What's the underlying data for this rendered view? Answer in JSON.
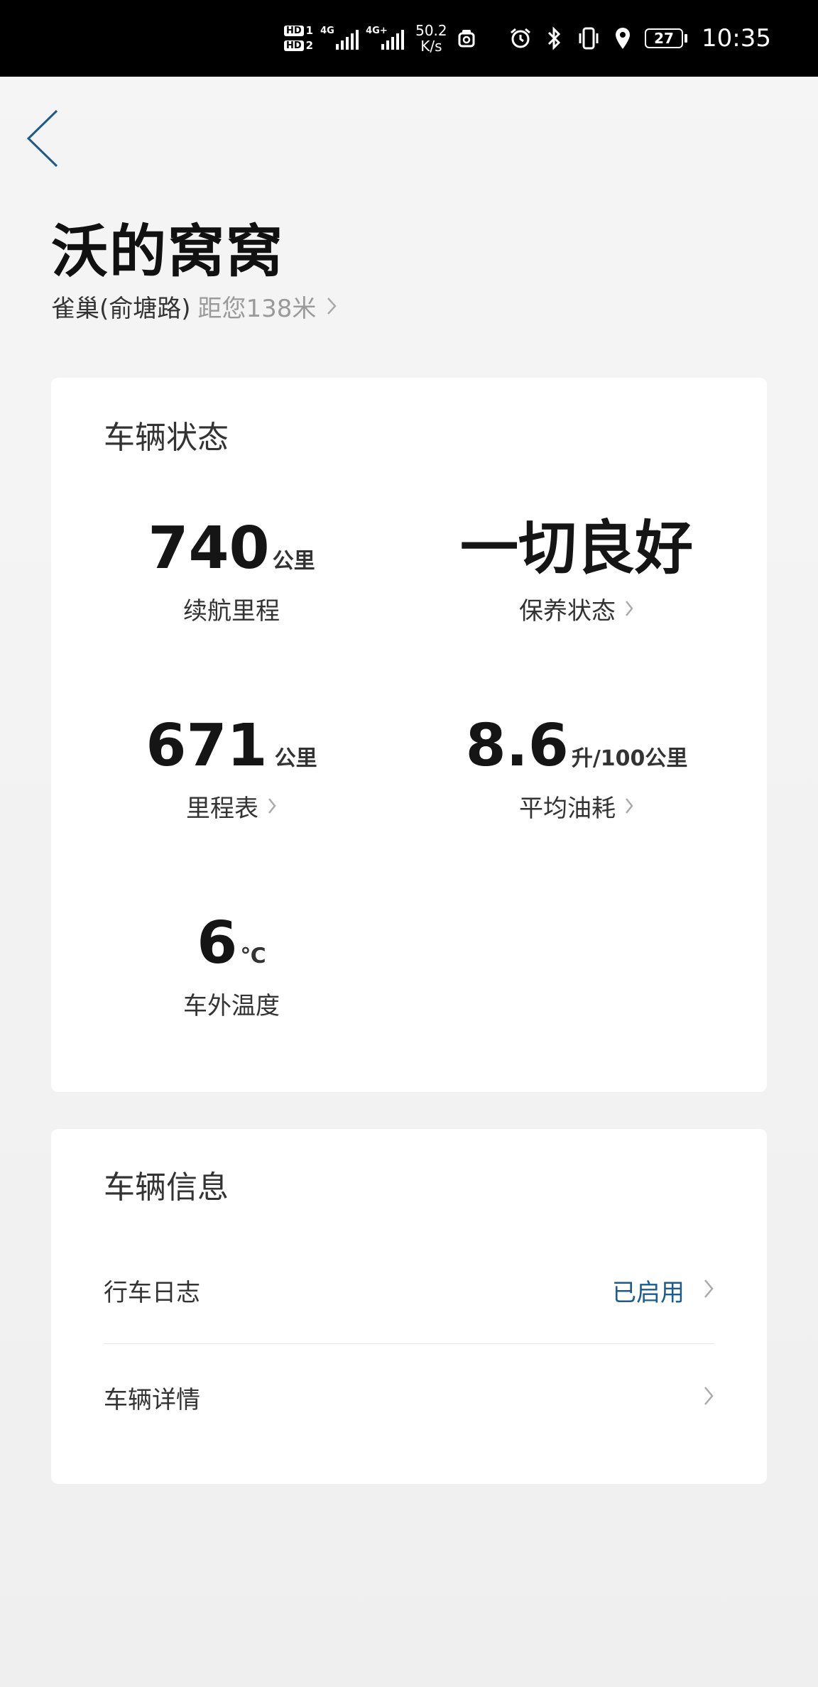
{
  "status_bar": {
    "hd1": "HD",
    "hd1_num": "1",
    "hd2": "HD",
    "hd2_num": "2",
    "sim1_tag": "4G",
    "sim2_tag": "4G+",
    "speed_value": "50.2",
    "speed_unit": "K/s",
    "battery": "27",
    "time": "10:35"
  },
  "header": {
    "title": "沃的窝窝",
    "location_name": "雀巢(俞塘路)",
    "location_distance": "距您138米"
  },
  "vehicle_status": {
    "title": "车辆状态",
    "items": [
      {
        "value": "740",
        "unit": "公里",
        "label": "续航里程"
      },
      {
        "value": "一切良好",
        "unit": "",
        "label": "保养状态"
      },
      {
        "value": "671",
        "unit": "公里",
        "label": "里程表"
      },
      {
        "value": "8.6",
        "unit": "升/100公里",
        "label": "平均油耗"
      },
      {
        "value": "6",
        "unit": "℃",
        "label": "车外温度"
      }
    ]
  },
  "vehicle_info": {
    "title": "车辆信息",
    "rows": [
      {
        "label": "行车日志",
        "value": "已启用"
      },
      {
        "label": "车辆详情",
        "value": ""
      }
    ]
  },
  "colors": {
    "accent_blue": "#1a5c8f",
    "back_arrow": "#1f5a8a",
    "status_bar_bg": "#000000"
  }
}
